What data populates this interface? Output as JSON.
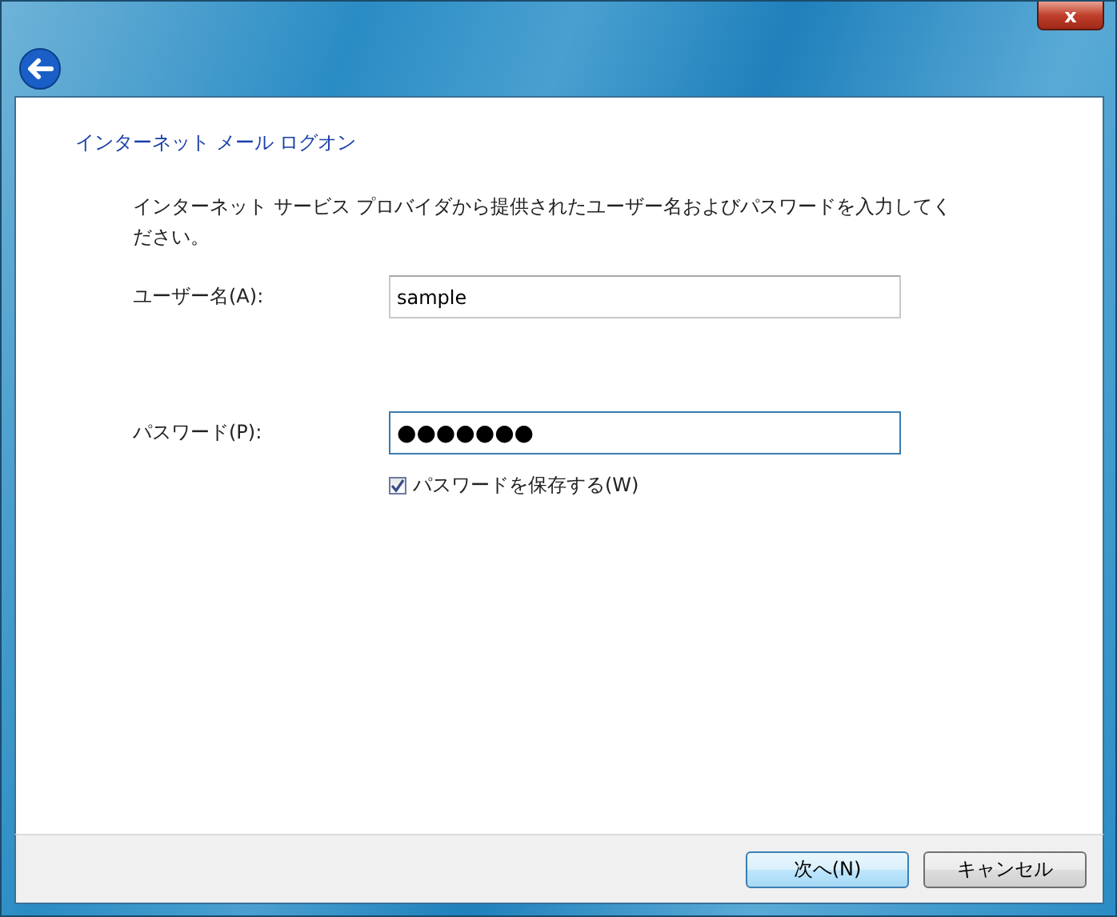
{
  "window": {
    "close_label": "x"
  },
  "heading": "インターネット メール ログオン",
  "instructions": "インターネット サービス プロバイダから提供されたユーザー名およびパスワードを入力してください。",
  "fields": [
    {
      "label": "ユーザー名(A):",
      "value": "sample",
      "focused": false
    },
    {
      "label": "パスワード(P):",
      "value": "●●●●●●●",
      "focused": true
    }
  ],
  "remember": {
    "label": "パスワードを保存する(W)",
    "checked": true
  },
  "buttons": [
    {
      "label": "次へ(N)",
      "default": true
    },
    {
      "label": "キャンセル",
      "default": false
    }
  ]
}
